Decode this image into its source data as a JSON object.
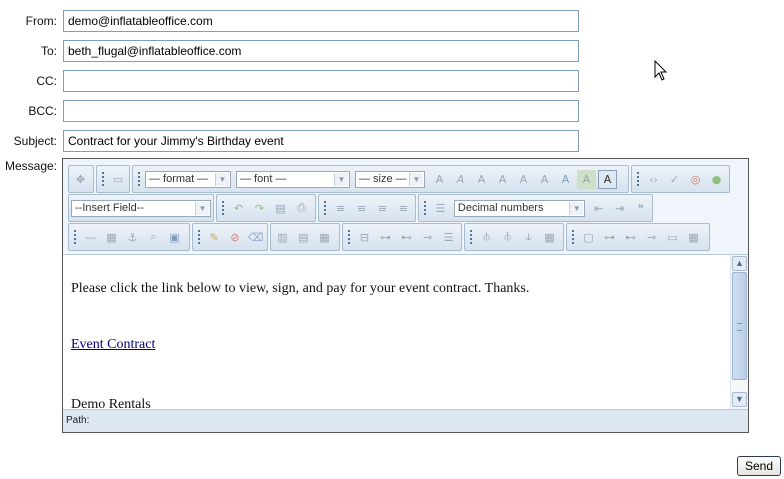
{
  "form": {
    "from_label": "From:",
    "from_value": "demo@inflatableoffice.com",
    "to_label": "To:",
    "to_value": "beth_flugal@inflatableoffice.com",
    "cc_label": "CC:",
    "cc_value": "",
    "bcc_label": "BCC:",
    "bcc_value": "",
    "subject_label": "Subject:",
    "subject_value": "Contract for your Jimmy's Birthday event",
    "message_label": "Message:"
  },
  "toolbar": {
    "format_select": "— format —",
    "font_select": "— font —",
    "size_select": "— size —",
    "insert_field_select": "--Insert Field--",
    "list_style_select": "Decimal numbers"
  },
  "message": {
    "line1": "Please click the link below to view, sign, and pay for your event contract. Thanks.",
    "link_text": "Event Contract",
    "signature": "Demo Rentals"
  },
  "status": {
    "path_label": "Path:"
  },
  "actions": {
    "send_label": "Send"
  }
}
